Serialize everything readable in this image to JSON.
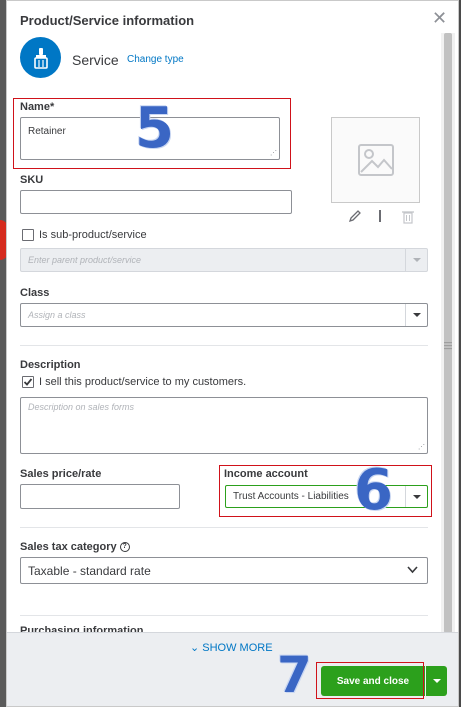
{
  "dialog": {
    "title": "Product/Service information",
    "type_label": "Service",
    "change_type": "Change type"
  },
  "fields": {
    "name_label": "Name*",
    "name_value": "Retainer",
    "sku_label": "SKU",
    "sub_product_label": "Is sub-product/service",
    "parent_placeholder": "Enter parent product/service",
    "class_label": "Class",
    "class_placeholder": "Assign a class",
    "description_label": "Description",
    "sell_label": "I sell this product/service to my customers.",
    "description_placeholder": "Description on sales forms",
    "sales_price_label": "Sales price/rate",
    "income_account_label": "Income account",
    "income_account_value": "Trust Accounts - Liabilities",
    "sales_tax_label": "Sales tax category",
    "sales_tax_value": "Taxable - standard rate",
    "purchasing_label": "Purchasing information"
  },
  "footer": {
    "show_more": "SHOW MORE",
    "save_close": "Save and close"
  },
  "annotations": {
    "step5": "5",
    "step6": "6",
    "step7": "7"
  },
  "state": {
    "sub_product_checked": false,
    "sell_checked": true
  }
}
